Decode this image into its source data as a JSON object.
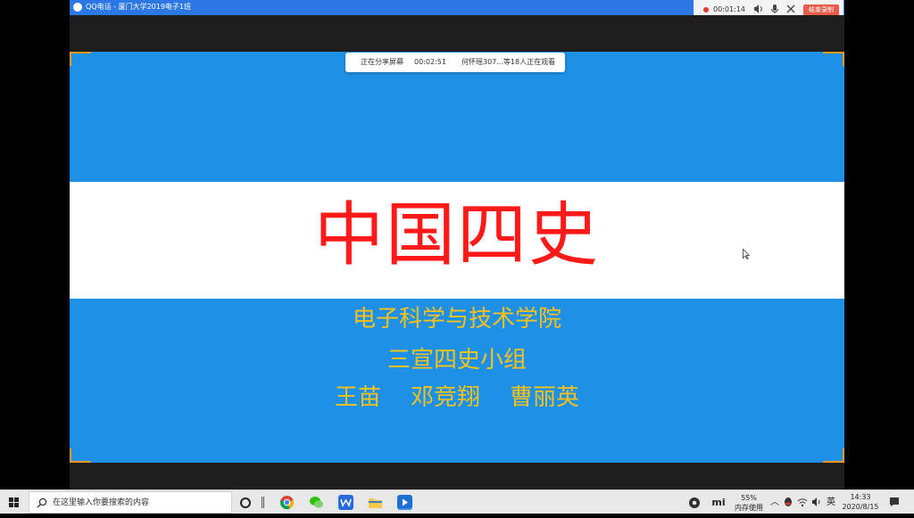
{
  "window": {
    "title": "QQ电话 - 厦门大学2019电子1班"
  },
  "recording": {
    "time": "00:01:14",
    "stop_label": "结束录制"
  },
  "sharing": {
    "status": "正在分享屏幕",
    "duration": "00:02:51",
    "viewers": "何怀瑶307...等18人正在观看"
  },
  "slide": {
    "title": "中国四史",
    "line1": "电子科学与技术学院",
    "line2": "三宣四史小组",
    "line3": "王苗    邓竞翔    曹丽英"
  },
  "taskbar": {
    "search_placeholder": "在这里输入你要搜索的内容",
    "memory_percent": "55%",
    "memory_label": "内存使用",
    "ime": "英",
    "time": "14:33",
    "date": "2020/8/15"
  },
  "colors": {
    "slide_blue": "#1e90e6",
    "title_red": "#ff1a1a",
    "subtitle_gold": "#f6c21a",
    "record_red": "#e85d4a"
  }
}
